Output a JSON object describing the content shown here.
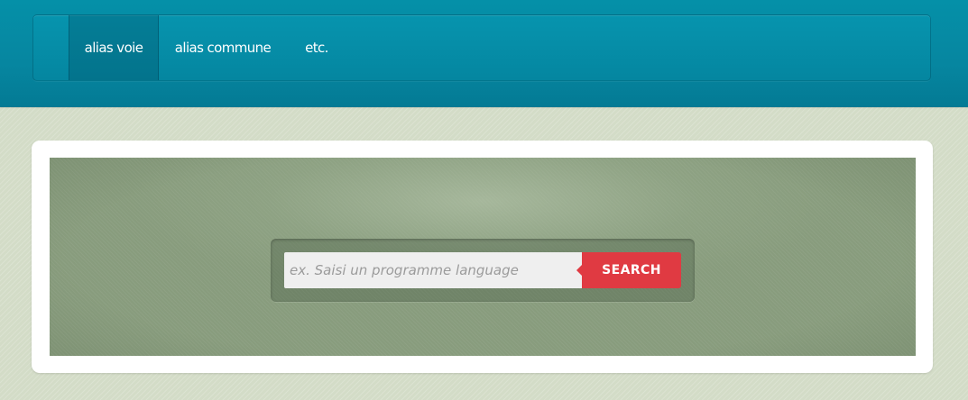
{
  "nav": {
    "items": [
      {
        "label": "alias voie",
        "active": true
      },
      {
        "label": "alias commune",
        "active": false
      },
      {
        "label": "etc.",
        "active": false
      }
    ]
  },
  "search": {
    "placeholder": "ex. Saisi un programme language",
    "value": "",
    "button_label": "SEARCH"
  },
  "colors": {
    "header_teal": "#0590a8",
    "page_background": "#d3dcc7",
    "hero_green": "#889c7d",
    "search_button_red": "#e03a42"
  }
}
